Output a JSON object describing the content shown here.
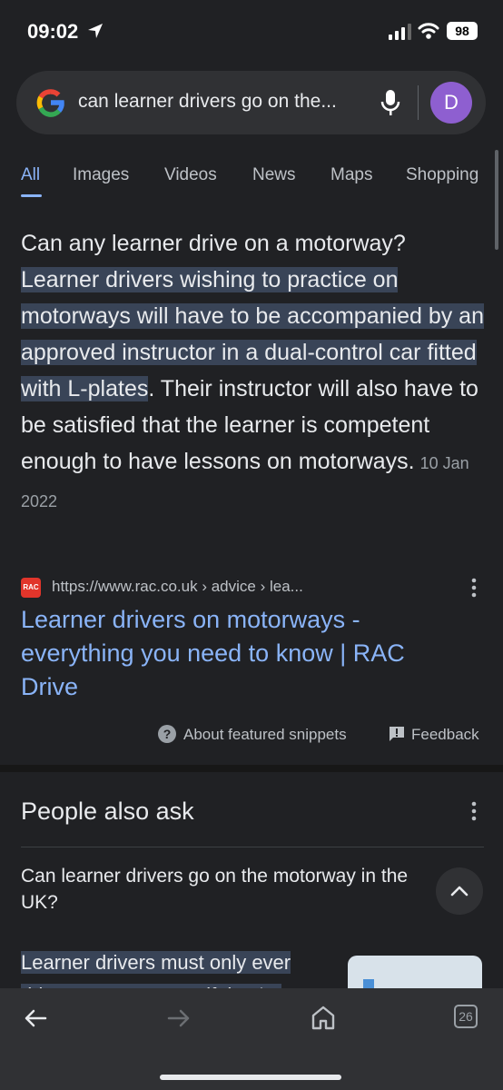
{
  "status_bar": {
    "time": "09:02",
    "battery": "98"
  },
  "search": {
    "query": "can learner drivers go on the...",
    "avatar_letter": "D"
  },
  "tabs": [
    {
      "label": "All"
    },
    {
      "label": "Images"
    },
    {
      "label": "Videos"
    },
    {
      "label": "News"
    },
    {
      "label": "Maps"
    },
    {
      "label": "Shopping"
    }
  ],
  "snippet": {
    "question": "Can any learner drive on a motorway? ",
    "highlight": "Learner drivers wishing to practice on motorways will have to be accompanied by an approved instructor in a dual-control car fitted with L-plates",
    "rest": ". Their instructor will also have to be satisfied that the learner is competent enough to have lessons on motorways.",
    "date": "10 Jan 2022"
  },
  "source": {
    "favicon_text": "RAC",
    "url": "https://www.rac.co.uk › advice › lea...",
    "title": "Learner drivers on motorways - everything you need to know | RAC Drive"
  },
  "snippet_footer": {
    "about": "About featured snippets",
    "feedback": "Feedback"
  },
  "people_also_ask": {
    "title": "People also ask",
    "question": "Can learner drivers go on the motorway in the UK?",
    "answer_preview": "Learner drivers must only ever drive on a motorway if they're"
  },
  "bottom_nav": {
    "tabs_count": "26"
  },
  "colors": {
    "background": "#202124",
    "link": "#8ab4f8",
    "highlight": "#394457",
    "avatar": "#8e5fd0"
  }
}
